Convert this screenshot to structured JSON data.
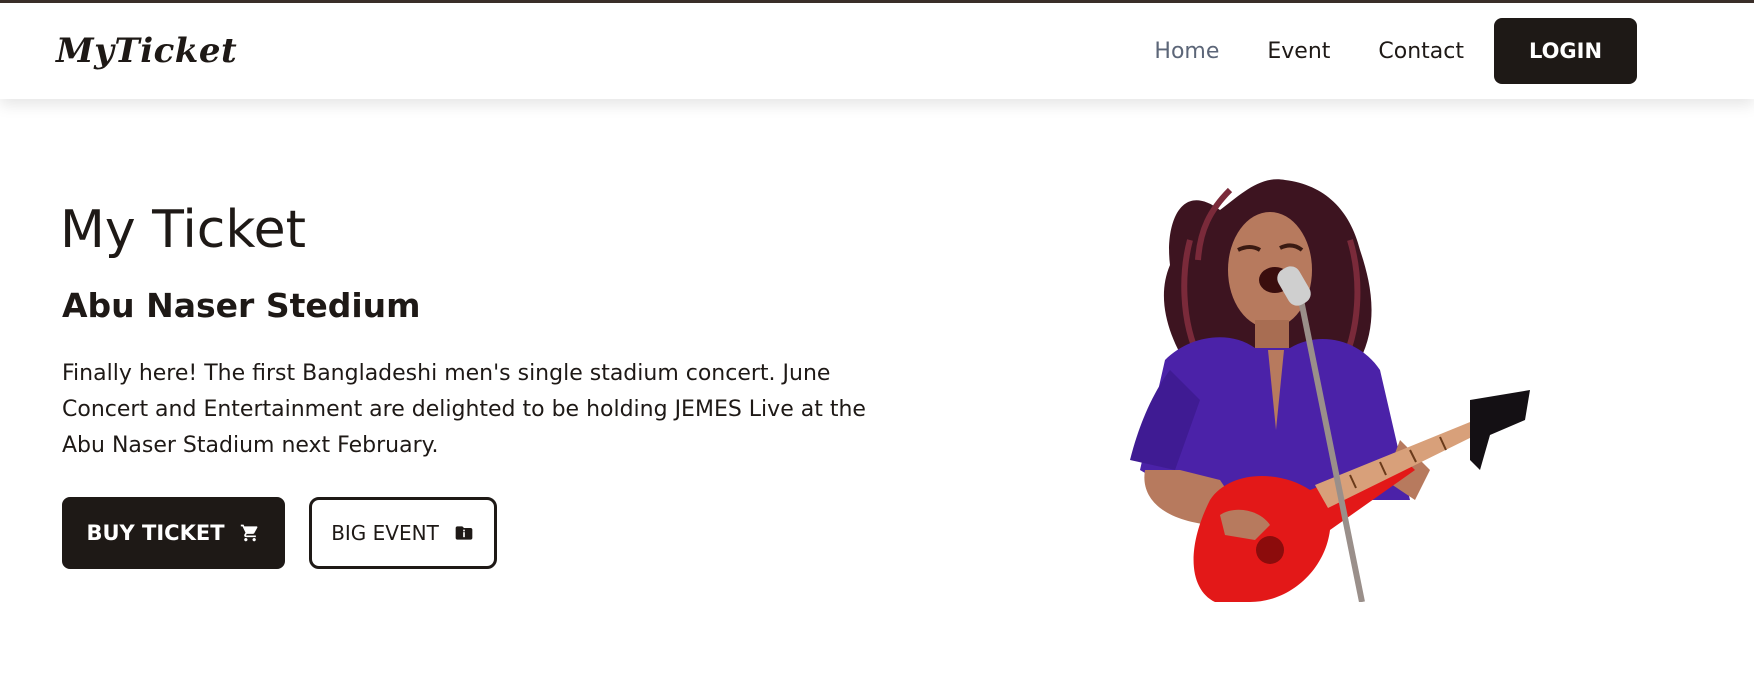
{
  "navbar": {
    "brand": "MyTicket",
    "links": [
      {
        "label": "Home",
        "active": true
      },
      {
        "label": "Event",
        "active": false
      },
      {
        "label": "Contact",
        "active": false
      }
    ],
    "login_label": "LOGIN"
  },
  "hero": {
    "title": "My Ticket",
    "subtitle": "Abu Naser Stedium",
    "description": "Finally here! The first Bangladeshi men's single stadium concert. June Concert and Entertainment are delighted to be holding JEMES Live at the Abu Naser Stadium next February.",
    "buy_label": "BUY TICKET",
    "buy_icon": "cart-icon",
    "event_label": "BIG EVENT",
    "event_icon": "folder-info-icon",
    "image": "guitarist-singing-photo"
  },
  "colors": {
    "primary": "#1e1916",
    "active_link": "#5c6678",
    "background": "#ffffff"
  }
}
